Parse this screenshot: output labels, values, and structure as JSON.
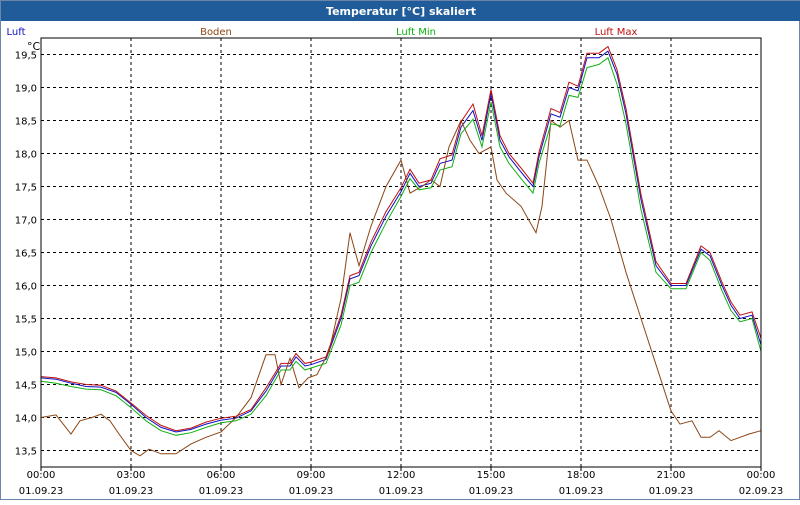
{
  "chart_data": {
    "type": "line",
    "title": "Temperatur [°C] skaliert",
    "ylabel": "°C",
    "xlabel": "",
    "ylim": [
      13.25,
      19.75
    ],
    "yticks": [
      13.5,
      14.0,
      14.5,
      15.0,
      15.5,
      16.0,
      16.5,
      17.0,
      17.5,
      18.0,
      18.5,
      19.0,
      19.5
    ],
    "ytick_labels": [
      "13,5",
      "14,0",
      "14,5",
      "15,0",
      "15,5",
      "16,0",
      "16,5",
      "17,0",
      "17,5",
      "18,0",
      "18,5",
      "19,0",
      "19,5"
    ],
    "x_range_hours": [
      0,
      24
    ],
    "xticks": [
      {
        "time": "00:00",
        "date": "01.09.23",
        "hour": 0
      },
      {
        "time": "03:00",
        "date": "01.09.23",
        "hour": 3
      },
      {
        "time": "06:00",
        "date": "01.09.23",
        "hour": 6
      },
      {
        "time": "09:00",
        "date": "01.09.23",
        "hour": 9
      },
      {
        "time": "12:00",
        "date": "01.09.23",
        "hour": 12
      },
      {
        "time": "15:00",
        "date": "01.09.23",
        "hour": 15
      },
      {
        "time": "18:00",
        "date": "01.09.23",
        "hour": 18
      },
      {
        "time": "21:00",
        "date": "01.09.23",
        "hour": 21
      },
      {
        "time": "00:00",
        "date": "02.09.23",
        "hour": 24
      }
    ],
    "grid": true,
    "legend_position": "top",
    "series": [
      {
        "name": "Luft",
        "color": "#1010c8",
        "points": [
          [
            0,
            14.6
          ],
          [
            0.5,
            14.58
          ],
          [
            1,
            14.52
          ],
          [
            1.5,
            14.47
          ],
          [
            2,
            14.46
          ],
          [
            2.5,
            14.38
          ],
          [
            3,
            14.2
          ],
          [
            3.5,
            14.0
          ],
          [
            4,
            13.85
          ],
          [
            4.5,
            13.78
          ],
          [
            5,
            13.82
          ],
          [
            5.5,
            13.9
          ],
          [
            6,
            13.96
          ],
          [
            6.5,
            13.99
          ],
          [
            7,
            14.1
          ],
          [
            7.5,
            14.4
          ],
          [
            8,
            14.78
          ],
          [
            8.3,
            14.78
          ],
          [
            8.5,
            14.92
          ],
          [
            8.8,
            14.78
          ],
          [
            9,
            14.8
          ],
          [
            9.5,
            14.88
          ],
          [
            10,
            15.5
          ],
          [
            10.3,
            16.1
          ],
          [
            10.6,
            16.15
          ],
          [
            11,
            16.6
          ],
          [
            11.5,
            17.05
          ],
          [
            12,
            17.42
          ],
          [
            12.3,
            17.7
          ],
          [
            12.6,
            17.5
          ],
          [
            13,
            17.55
          ],
          [
            13.3,
            17.85
          ],
          [
            13.7,
            17.9
          ],
          [
            14,
            18.4
          ],
          [
            14.4,
            18.65
          ],
          [
            14.7,
            18.2
          ],
          [
            15,
            18.9
          ],
          [
            15.3,
            18.2
          ],
          [
            15.6,
            17.95
          ],
          [
            16,
            17.72
          ],
          [
            16.4,
            17.5
          ],
          [
            16.6,
            17.95
          ],
          [
            17,
            18.6
          ],
          [
            17.3,
            18.55
          ],
          [
            17.6,
            19.0
          ],
          [
            17.9,
            18.95
          ],
          [
            18.2,
            19.45
          ],
          [
            18.6,
            19.45
          ],
          [
            18.9,
            19.55
          ],
          [
            19.2,
            19.2
          ],
          [
            19.5,
            18.6
          ],
          [
            20,
            17.3
          ],
          [
            20.5,
            16.3
          ],
          [
            21,
            16.0
          ],
          [
            21.5,
            16.0
          ],
          [
            22,
            16.55
          ],
          [
            22.3,
            16.45
          ],
          [
            22.7,
            16.0
          ],
          [
            23,
            15.7
          ],
          [
            23.3,
            15.5
          ],
          [
            23.7,
            15.55
          ],
          [
            24,
            15.1
          ]
        ]
      },
      {
        "name": "Boden",
        "color": "#8b4513",
        "points": [
          [
            0,
            14.0
          ],
          [
            0.5,
            14.04
          ],
          [
            1,
            13.75
          ],
          [
            1.3,
            13.95
          ],
          [
            1.7,
            14.0
          ],
          [
            2,
            14.05
          ],
          [
            2.3,
            13.95
          ],
          [
            2.6,
            13.75
          ],
          [
            3,
            13.5
          ],
          [
            3.3,
            13.42
          ],
          [
            3.6,
            13.52
          ],
          [
            4,
            13.45
          ],
          [
            4.5,
            13.45
          ],
          [
            5,
            13.6
          ],
          [
            5.5,
            13.7
          ],
          [
            6,
            13.78
          ],
          [
            6.5,
            14.0
          ],
          [
            7,
            14.3
          ],
          [
            7.5,
            14.95
          ],
          [
            7.8,
            14.95
          ],
          [
            8,
            14.5
          ],
          [
            8.3,
            14.9
          ],
          [
            8.6,
            14.45
          ],
          [
            8.9,
            14.6
          ],
          [
            9.2,
            14.65
          ],
          [
            9.6,
            15.0
          ],
          [
            10,
            15.8
          ],
          [
            10.3,
            16.8
          ],
          [
            10.6,
            16.3
          ],
          [
            11,
            16.9
          ],
          [
            11.5,
            17.5
          ],
          [
            12,
            17.9
          ],
          [
            12.3,
            17.4
          ],
          [
            12.7,
            17.5
          ],
          [
            13,
            17.6
          ],
          [
            13.3,
            17.5
          ],
          [
            13.6,
            18.1
          ],
          [
            14,
            18.5
          ],
          [
            14.3,
            18.2
          ],
          [
            14.6,
            18.0
          ],
          [
            15,
            18.1
          ],
          [
            15.2,
            17.6
          ],
          [
            15.5,
            17.4
          ],
          [
            16,
            17.2
          ],
          [
            16.5,
            16.8
          ],
          [
            16.7,
            17.2
          ],
          [
            17,
            18.5
          ],
          [
            17.3,
            18.4
          ],
          [
            17.6,
            18.5
          ],
          [
            17.9,
            17.9
          ],
          [
            18.2,
            17.9
          ],
          [
            18.6,
            17.5
          ],
          [
            19,
            17.0
          ],
          [
            19.5,
            16.2
          ],
          [
            20,
            15.5
          ],
          [
            20.5,
            14.8
          ],
          [
            21,
            14.1
          ],
          [
            21.3,
            13.9
          ],
          [
            21.7,
            13.95
          ],
          [
            22,
            13.7
          ],
          [
            22.3,
            13.7
          ],
          [
            22.6,
            13.8
          ],
          [
            23,
            13.65
          ],
          [
            23.3,
            13.7
          ],
          [
            23.6,
            13.75
          ],
          [
            24,
            13.8
          ]
        ]
      },
      {
        "name": "Luft Min",
        "color": "#10b010",
        "points": [
          [
            0,
            14.55
          ],
          [
            0.5,
            14.52
          ],
          [
            1,
            14.47
          ],
          [
            1.5,
            14.43
          ],
          [
            2,
            14.42
          ],
          [
            2.5,
            14.33
          ],
          [
            3,
            14.15
          ],
          [
            3.5,
            13.95
          ],
          [
            4,
            13.8
          ],
          [
            4.5,
            13.73
          ],
          [
            5,
            13.77
          ],
          [
            5.5,
            13.85
          ],
          [
            6,
            13.92
          ],
          [
            6.5,
            13.95
          ],
          [
            7,
            14.05
          ],
          [
            7.5,
            14.33
          ],
          [
            8,
            14.72
          ],
          [
            8.3,
            14.72
          ],
          [
            8.5,
            14.85
          ],
          [
            8.8,
            14.72
          ],
          [
            9,
            14.75
          ],
          [
            9.5,
            14.82
          ],
          [
            10,
            15.4
          ],
          [
            10.3,
            16.0
          ],
          [
            10.6,
            16.05
          ],
          [
            11,
            16.5
          ],
          [
            11.5,
            16.95
          ],
          [
            12,
            17.35
          ],
          [
            12.3,
            17.62
          ],
          [
            12.6,
            17.45
          ],
          [
            13,
            17.48
          ],
          [
            13.3,
            17.75
          ],
          [
            13.7,
            17.8
          ],
          [
            14,
            18.3
          ],
          [
            14.4,
            18.52
          ],
          [
            14.7,
            18.1
          ],
          [
            15,
            18.78
          ],
          [
            15.3,
            18.1
          ],
          [
            15.6,
            17.85
          ],
          [
            16,
            17.62
          ],
          [
            16.4,
            17.4
          ],
          [
            16.6,
            17.85
          ],
          [
            17,
            18.45
          ],
          [
            17.3,
            18.42
          ],
          [
            17.6,
            18.88
          ],
          [
            17.9,
            18.85
          ],
          [
            18.2,
            19.3
          ],
          [
            18.6,
            19.35
          ],
          [
            18.9,
            19.45
          ],
          [
            19.2,
            19.05
          ],
          [
            19.5,
            18.45
          ],
          [
            20,
            17.15
          ],
          [
            20.5,
            16.2
          ],
          [
            21,
            15.95
          ],
          [
            21.5,
            15.95
          ],
          [
            22,
            16.5
          ],
          [
            22.3,
            16.38
          ],
          [
            22.7,
            15.92
          ],
          [
            23,
            15.62
          ],
          [
            23.3,
            15.45
          ],
          [
            23.7,
            15.5
          ],
          [
            24,
            15.0
          ]
        ]
      },
      {
        "name": "Luft Max",
        "color": "#c01010",
        "points": [
          [
            0,
            14.62
          ],
          [
            0.5,
            14.6
          ],
          [
            1,
            14.54
          ],
          [
            1.5,
            14.5
          ],
          [
            2,
            14.49
          ],
          [
            2.5,
            14.4
          ],
          [
            3,
            14.22
          ],
          [
            3.5,
            14.03
          ],
          [
            4,
            13.88
          ],
          [
            4.5,
            13.8
          ],
          [
            5,
            13.84
          ],
          [
            5.5,
            13.93
          ],
          [
            6,
            13.99
          ],
          [
            6.5,
            14.02
          ],
          [
            7,
            14.12
          ],
          [
            7.5,
            14.45
          ],
          [
            8,
            14.82
          ],
          [
            8.3,
            14.82
          ],
          [
            8.5,
            14.97
          ],
          [
            8.8,
            14.82
          ],
          [
            9,
            14.84
          ],
          [
            9.5,
            14.92
          ],
          [
            10,
            15.55
          ],
          [
            10.3,
            16.15
          ],
          [
            10.6,
            16.2
          ],
          [
            11,
            16.66
          ],
          [
            11.5,
            17.12
          ],
          [
            12,
            17.48
          ],
          [
            12.3,
            17.76
          ],
          [
            12.6,
            17.55
          ],
          [
            13,
            17.6
          ],
          [
            13.3,
            17.92
          ],
          [
            13.7,
            17.98
          ],
          [
            14,
            18.48
          ],
          [
            14.4,
            18.75
          ],
          [
            14.7,
            18.27
          ],
          [
            15,
            18.97
          ],
          [
            15.3,
            18.27
          ],
          [
            15.6,
            18.0
          ],
          [
            16,
            17.78
          ],
          [
            16.4,
            17.55
          ],
          [
            16.6,
            18.02
          ],
          [
            17,
            18.68
          ],
          [
            17.3,
            18.62
          ],
          [
            17.6,
            19.08
          ],
          [
            17.9,
            19.02
          ],
          [
            18.2,
            19.52
          ],
          [
            18.6,
            19.52
          ],
          [
            18.9,
            19.62
          ],
          [
            19.2,
            19.27
          ],
          [
            19.5,
            18.68
          ],
          [
            20,
            17.38
          ],
          [
            20.5,
            16.36
          ],
          [
            21,
            16.03
          ],
          [
            21.5,
            16.03
          ],
          [
            22,
            16.6
          ],
          [
            22.3,
            16.5
          ],
          [
            22.7,
            16.05
          ],
          [
            23,
            15.75
          ],
          [
            23.3,
            15.55
          ],
          [
            23.7,
            15.6
          ],
          [
            24,
            15.2
          ]
        ]
      }
    ]
  }
}
